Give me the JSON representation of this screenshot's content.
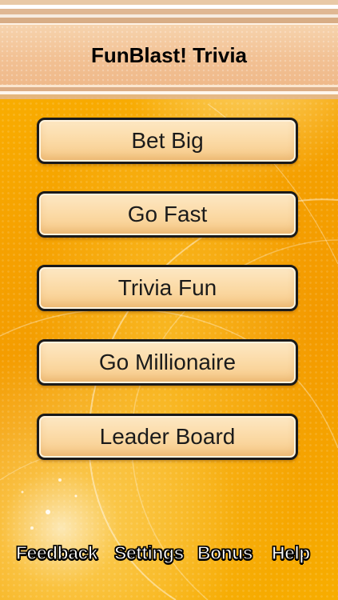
{
  "header": {
    "title": "FunBlast! Trivia"
  },
  "menu": {
    "items": [
      {
        "label": "Bet Big"
      },
      {
        "label": "Go Fast"
      },
      {
        "label": "Trivia Fun"
      },
      {
        "label": "Go Millionaire"
      },
      {
        "label": "Leader Board"
      }
    ]
  },
  "footer": {
    "links": [
      {
        "label": "Feedback"
      },
      {
        "label": "Settings"
      },
      {
        "label": "Bonus"
      },
      {
        "label": "Help"
      }
    ]
  },
  "colors": {
    "background": "#f7a400",
    "button_fill": "#fbdaa6",
    "button_border": "#1a1a1a",
    "header_band": "#f2c194"
  }
}
